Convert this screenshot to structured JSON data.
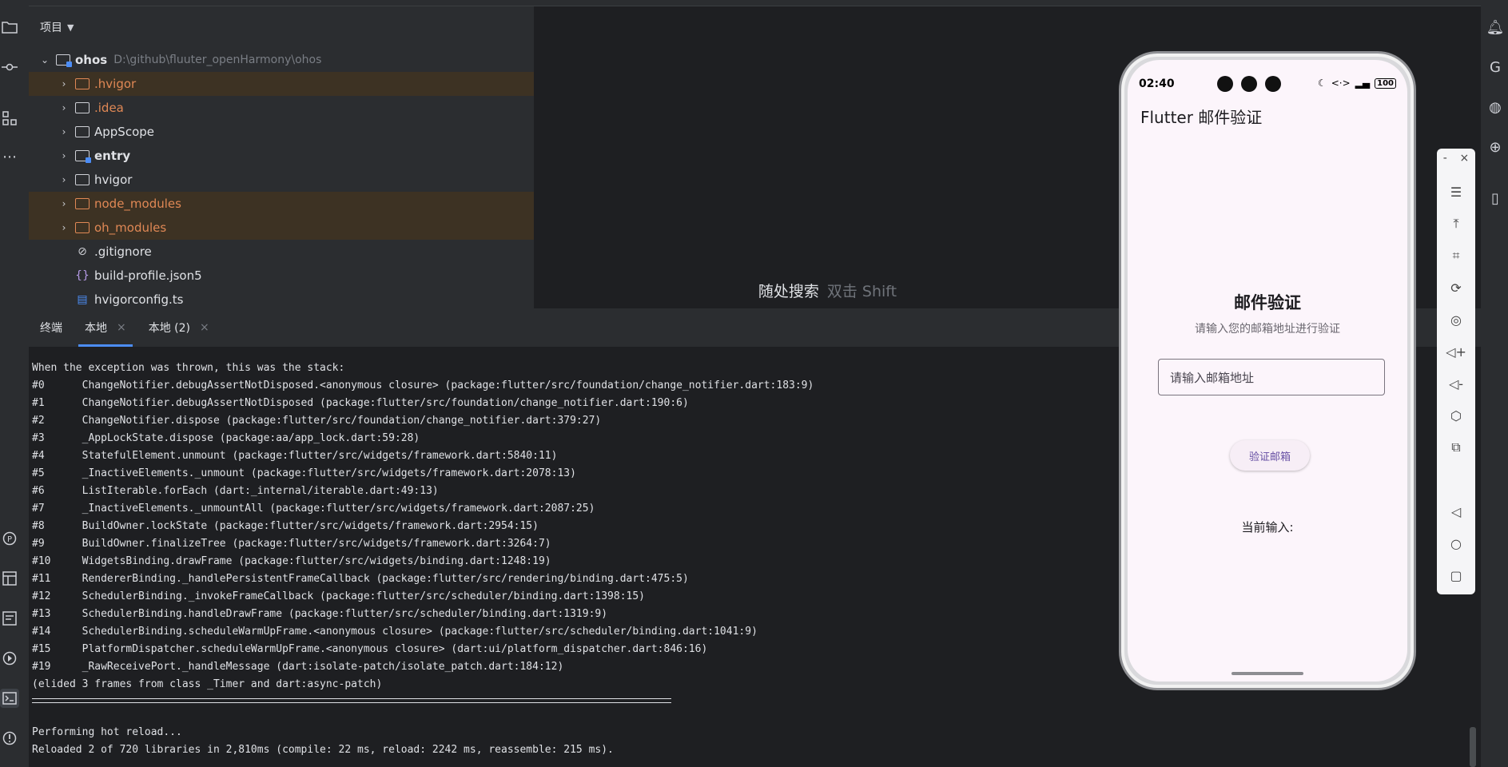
{
  "project": {
    "header_label": "项目",
    "root": {
      "name": "ohos",
      "path": "D:\\github\\fluuter_openHarmony\\ohos"
    },
    "items": [
      {
        "label": ".hvigor",
        "type": "folder",
        "excluded": true,
        "expandable": true
      },
      {
        "label": ".idea",
        "type": "folder",
        "excluded": false,
        "expandable": true
      },
      {
        "label": "AppScope",
        "type": "folder",
        "excluded": false,
        "expandable": true
      },
      {
        "label": "entry",
        "type": "module",
        "excluded": false,
        "expandable": true
      },
      {
        "label": "hvigor",
        "type": "folder",
        "excluded": false,
        "expandable": true
      },
      {
        "label": "node_modules",
        "type": "folder",
        "excluded": true,
        "expandable": true
      },
      {
        "label": "oh_modules",
        "type": "folder",
        "excluded": true,
        "expandable": true
      },
      {
        "label": ".gitignore",
        "type": "ignore-file",
        "excluded": false,
        "expandable": false
      },
      {
        "label": "build-profile.json5",
        "type": "json-file",
        "excluded": false,
        "expandable": false
      },
      {
        "label": "hvigorconfig.ts",
        "type": "ts-file",
        "excluded": false,
        "expandable": false
      }
    ]
  },
  "editor": {
    "hint_main": "随处搜索",
    "hint_key": "双击 Shift"
  },
  "terminal": {
    "tabs": [
      {
        "label": "终端",
        "closable": false,
        "active": false
      },
      {
        "label": "本地",
        "closable": true,
        "active": true
      },
      {
        "label": "本地 (2)",
        "closable": true,
        "active": false
      }
    ],
    "close_glyph": "×",
    "lines_top": [
      "When the exception was thrown, this was the stack:",
      "#0      ChangeNotifier.debugAssertNotDisposed.<anonymous closure> (package:flutter/src/foundation/change_notifier.dart:183:9)",
      "#1      ChangeNotifier.debugAssertNotDisposed (package:flutter/src/foundation/change_notifier.dart:190:6)",
      "#2      ChangeNotifier.dispose (package:flutter/src/foundation/change_notifier.dart:379:27)",
      "#3      _AppLockState.dispose (package:aa/app_lock.dart:59:28)",
      "#4      StatefulElement.unmount (package:flutter/src/widgets/framework.dart:5840:11)",
      "#5      _InactiveElements._unmount (package:flutter/src/widgets/framework.dart:2078:13)",
      "#6      ListIterable.forEach (dart:_internal/iterable.dart:49:13)",
      "#7      _InactiveElements._unmountAll (package:flutter/src/widgets/framework.dart:2087:25)",
      "#8      BuildOwner.lockState (package:flutter/src/widgets/framework.dart:2954:15)",
      "#9      BuildOwner.finalizeTree (package:flutter/src/widgets/framework.dart:3264:7)",
      "#10     WidgetsBinding.drawFrame (package:flutter/src/widgets/binding.dart:1248:19)",
      "#11     RendererBinding._handlePersistentFrameCallback (package:flutter/src/rendering/binding.dart:475:5)",
      "#12     SchedulerBinding._invokeFrameCallback (package:flutter/src/scheduler/binding.dart:1398:15)",
      "#13     SchedulerBinding.handleDrawFrame (package:flutter/src/scheduler/binding.dart:1319:9)",
      "#14     SchedulerBinding.scheduleWarmUpFrame.<anonymous closure> (package:flutter/src/scheduler/binding.dart:1041:9)",
      "#15     PlatformDispatcher.scheduleWarmUpFrame.<anonymous closure> (dart:ui/platform_dispatcher.dart:846:16)",
      "#19     _RawReceivePort._handleMessage (dart:isolate-patch/isolate_patch.dart:184:12)",
      "(elided 3 frames from class _Timer and dart:async-patch)"
    ],
    "lines_bottom": [
      "Performing hot reload...",
      "Reloaded 2 of 720 libraries in 2,810ms (compile: 22 ms, reload: 2242 ms, reassemble: 215 ms)."
    ]
  },
  "phone": {
    "status_time": "02:40",
    "battery": "100",
    "app_bar_title": "Flutter 邮件验证",
    "heading": "邮件验证",
    "subtitle": "请输入您的邮箱地址进行验证",
    "email_placeholder": "请输入邮箱地址",
    "button_label": "验证邮箱",
    "current_input_label": "当前输入:"
  },
  "emulator_toolbar": {
    "minimize_glyph": "-",
    "close_glyph": "×",
    "icons": [
      "menu-icon",
      "pin-top-icon",
      "screenshot-crop-icon",
      "rotate-icon",
      "location-icon",
      "volume-up-icon",
      "volume-down-icon",
      "shake-icon",
      "fold-icon",
      "back-icon",
      "home-icon",
      "recents-icon"
    ]
  }
}
